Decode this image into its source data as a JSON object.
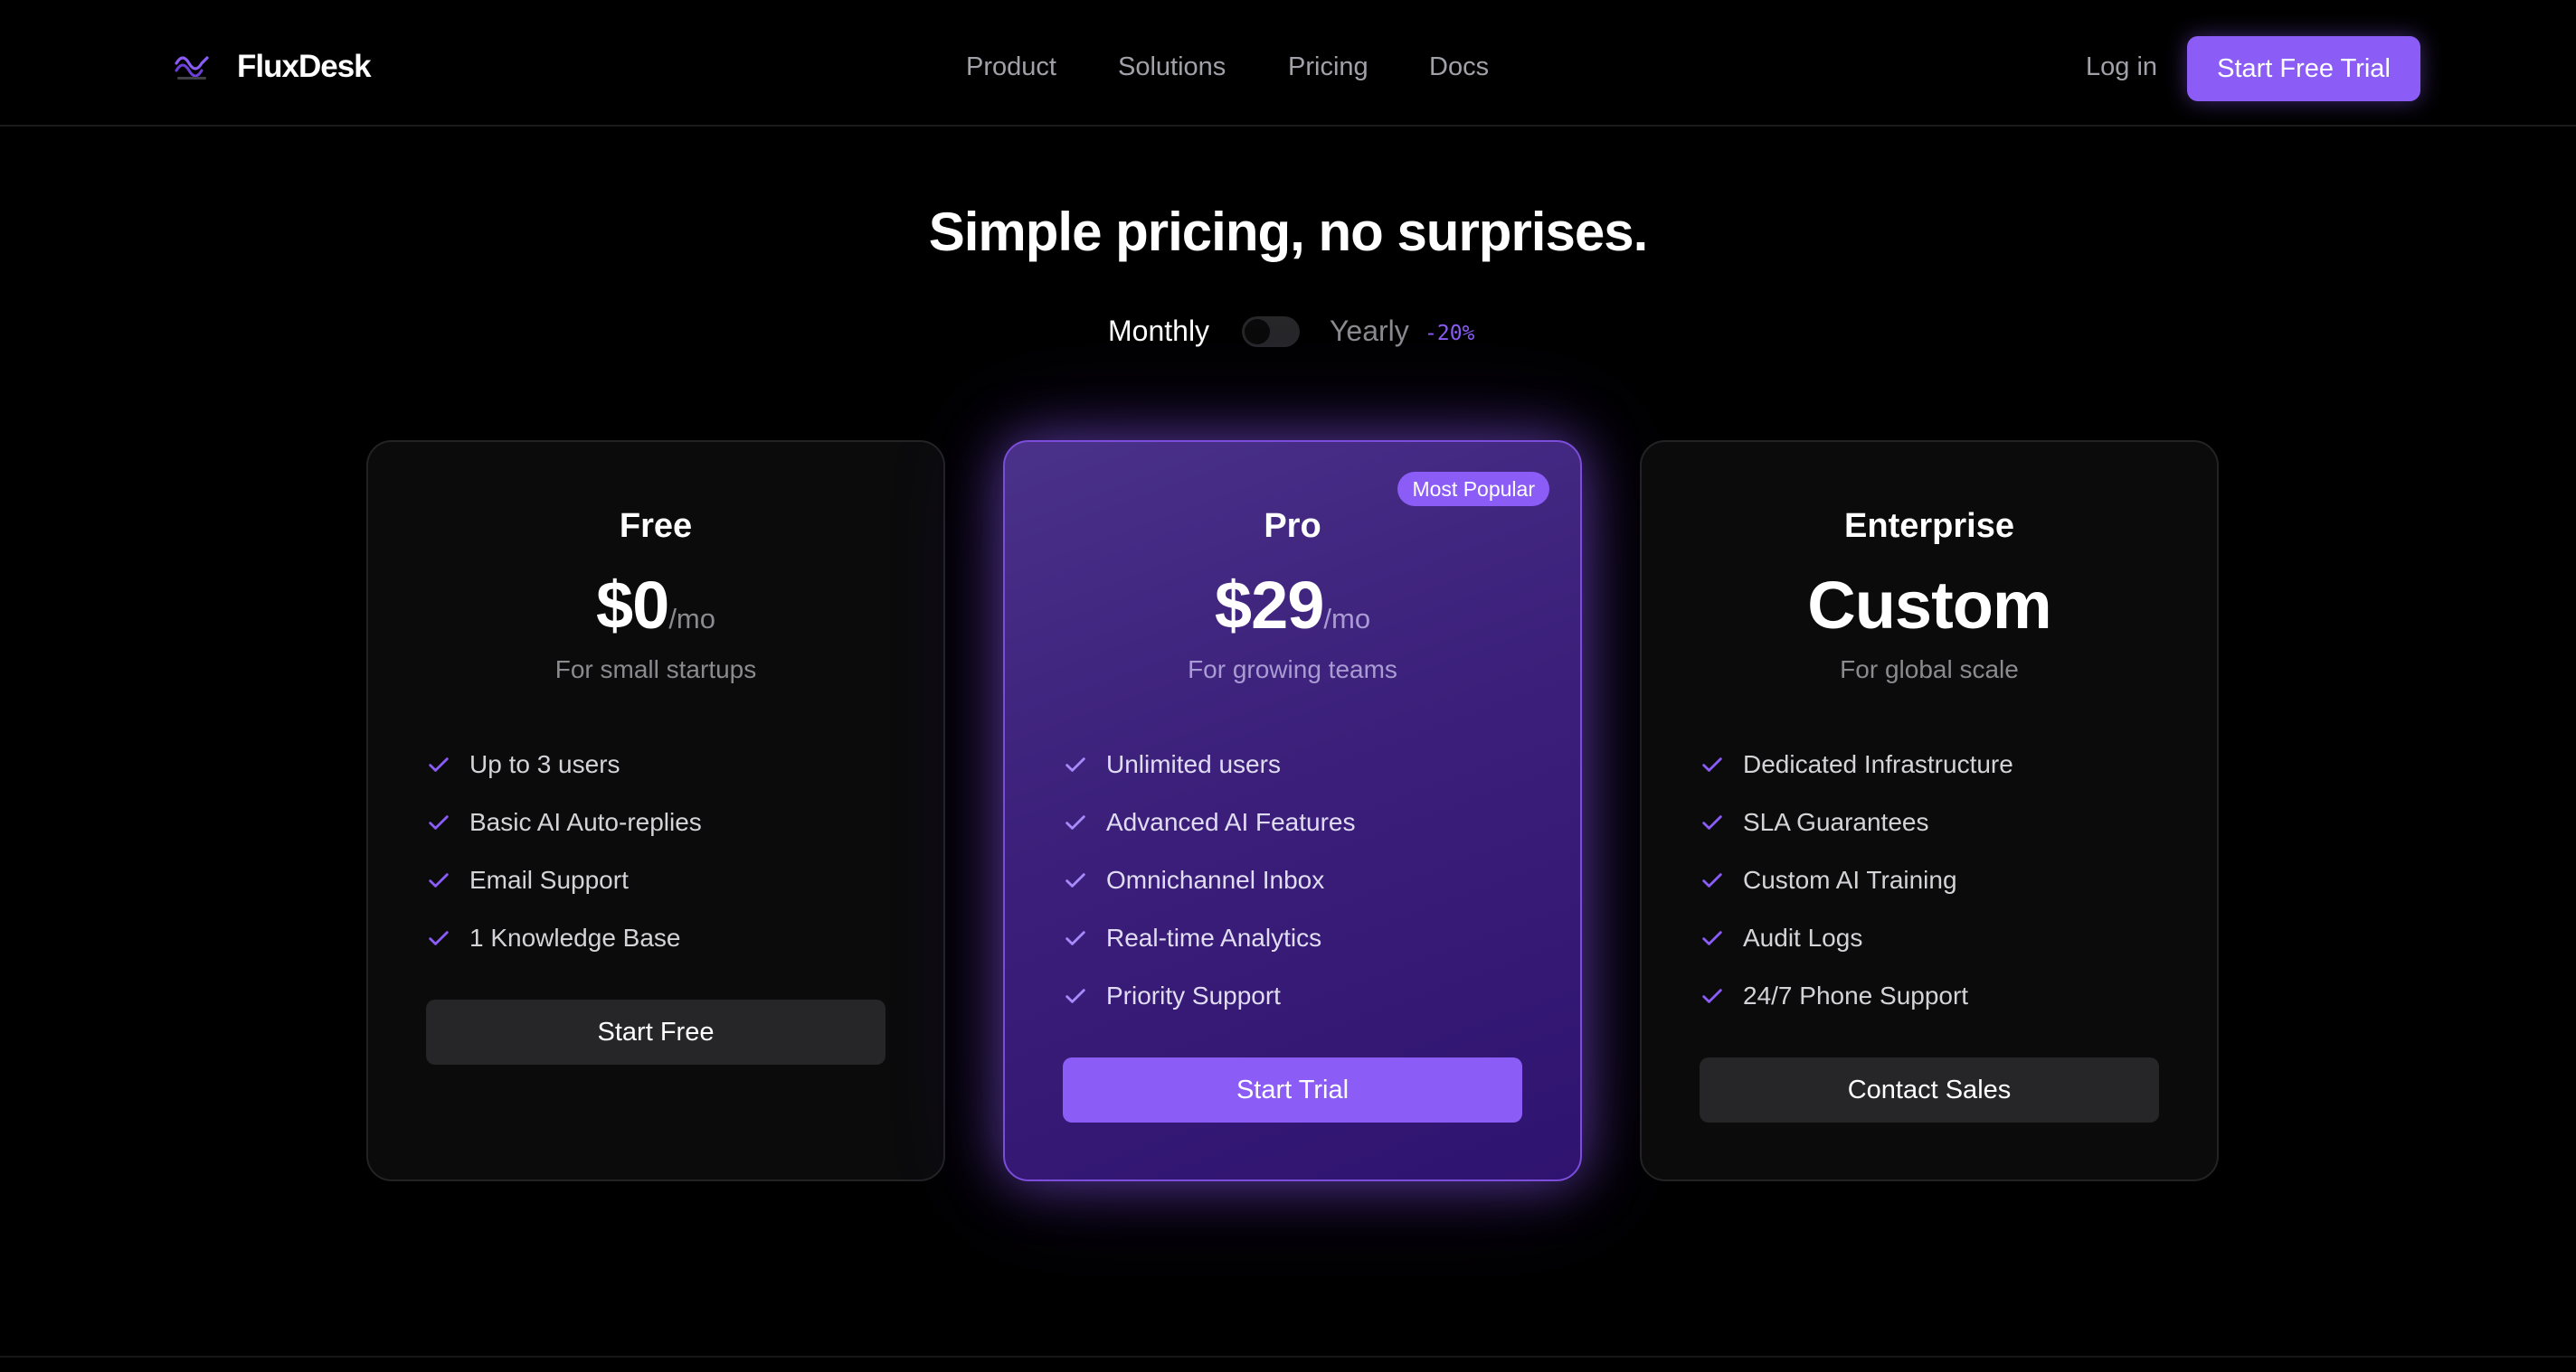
{
  "nav": {
    "brand": "FluxDesk",
    "logo_icon": "flux-wave-logo",
    "links": [
      "Product",
      "Solutions",
      "Pricing",
      "Docs"
    ],
    "login": "Log in",
    "cta": "Start Free Trial"
  },
  "hero": {
    "headline": "Simple pricing, no surprises.",
    "billing": {
      "monthly": "Monthly",
      "yearly": "Yearly",
      "discount": "-20%",
      "yearly_selected": false
    }
  },
  "plans": [
    {
      "name": "Free",
      "price": "$0",
      "period": "/mo",
      "tagline": "For small startups",
      "features": [
        "Up to 3 users",
        "Basic AI Auto-replies",
        "Email Support",
        "1 Knowledge Base"
      ],
      "button": "Start Free"
    },
    {
      "name": "Pro",
      "price": "$29",
      "period": "/mo",
      "tagline": "For growing teams",
      "badge": "Most Popular",
      "features": [
        "Unlimited users",
        "Advanced AI Features",
        "Omnichannel Inbox",
        "Real-time Analytics",
        "Priority Support"
      ],
      "button": "Start Trial"
    },
    {
      "name": "Enterprise",
      "price": "Custom",
      "tagline": "For global scale",
      "features": [
        "Dedicated Infrastructure",
        "SLA Guarantees",
        "Custom AI Training",
        "Audit Logs",
        "24/7 Phone Support"
      ],
      "button": "Contact Sales"
    }
  ],
  "colors": {
    "accent": "#8b5cf6",
    "background": "#000000",
    "card": "#0b0b0c",
    "muted_text": "#8a8a8f"
  }
}
